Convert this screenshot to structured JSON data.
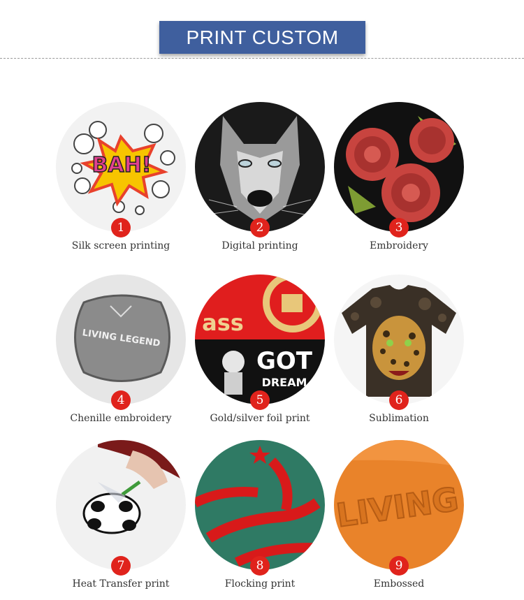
{
  "header": {
    "title": "PRINT CUSTOM"
  },
  "items": [
    {
      "number": "1",
      "label": "Silk screen printing"
    },
    {
      "number": "2",
      "label": "Digital printing"
    },
    {
      "number": "3",
      "label": "Embroidery"
    },
    {
      "number": "4",
      "label": "Chenille embroidery"
    },
    {
      "number": "5",
      "label": "Gold/silver foil print"
    },
    {
      "number": "6",
      "label": "Sublimation"
    },
    {
      "number": "7",
      "label": "Heat Transfer print"
    },
    {
      "number": "8",
      "label": "Flocking print"
    },
    {
      "number": "9",
      "label": "Embossed"
    }
  ],
  "image_text": {
    "item1": "BAH!",
    "item4_1": "LIVING LEGEND",
    "item5_1": "ass",
    "item5_2": "GOT",
    "item5_3": "DREAM",
    "item9": "LIVING"
  },
  "colors": {
    "header": "#3f5f9e",
    "badge": "#e0231c",
    "divider": "#9a9a9a"
  }
}
